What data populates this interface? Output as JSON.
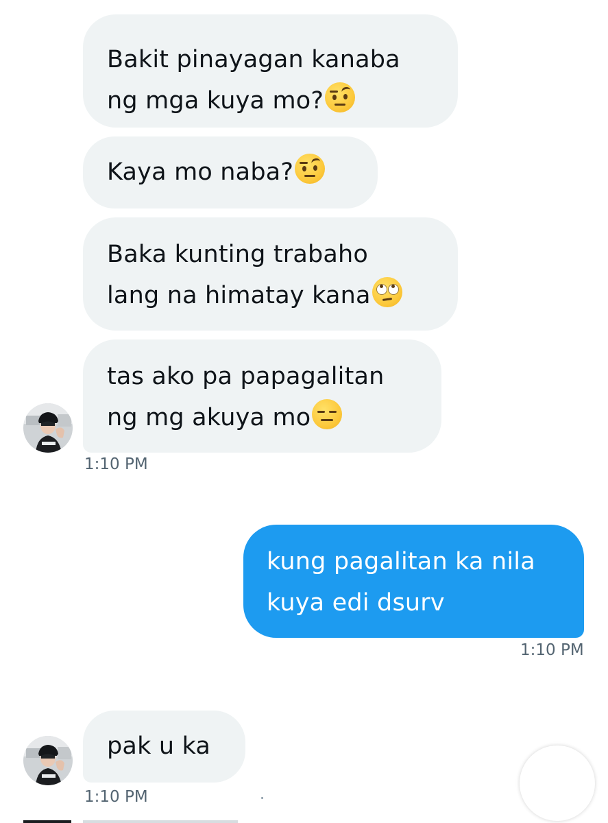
{
  "messages": [
    {
      "direction": "incoming",
      "lines": [
        "Bakit pinayagan kanaba",
        "ng mga kuya mo?"
      ],
      "emoji": "raised-eyebrow-face"
    },
    {
      "direction": "incoming",
      "lines": [
        "Kaya mo naba?"
      ],
      "emoji": "raised-eyebrow-face"
    },
    {
      "direction": "incoming",
      "lines": [
        "Baka kunting trabaho",
        "lang na himatay kana"
      ],
      "emoji": "face-with-rolling-eyes"
    },
    {
      "direction": "incoming",
      "lines": [
        "tas ako pa papagalitan",
        "ng mg akuya mo"
      ],
      "emoji": "expressionless-face"
    },
    {
      "direction": "outgoing",
      "lines": [
        "kung pagalitan ka nila",
        "kuya edi dsurv"
      ]
    },
    {
      "direction": "incoming",
      "lines": [
        "pak u ka"
      ]
    }
  ],
  "timestamps": {
    "incoming_group_1": "1:10 PM",
    "outgoing": "1:10 PM",
    "incoming_group_2": "1:10 PM"
  },
  "colors": {
    "incoming_bubble": "#eff3f4",
    "outgoing_bubble": "#1d9bf0",
    "outgoing_text": "#ffffff",
    "timestamp": "#536471"
  },
  "icons": {
    "avatar": "user-avatar",
    "scroll_button": "partial-circle-button"
  }
}
